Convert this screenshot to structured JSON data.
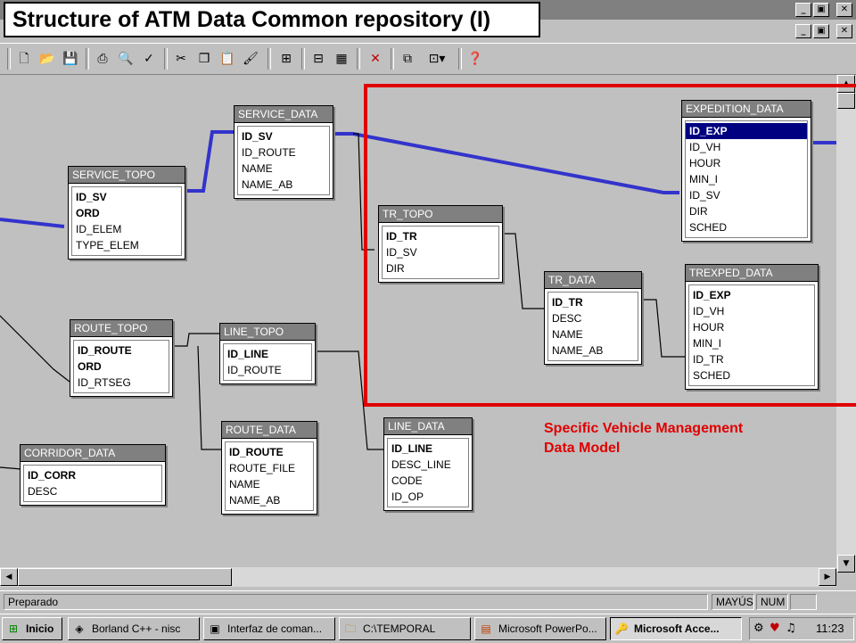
{
  "slide_title": "Structure of ATM Data Common repository (I)",
  "window_buttons": [
    "_",
    "▣",
    "✕"
  ],
  "toolbar_icons": [
    "new-icon",
    "open-icon",
    "save-icon",
    "print-icon",
    "print-preview-icon",
    "spelling-icon",
    "cut-icon",
    "copy-icon",
    "paste-icon",
    "format-painter-icon",
    "add-table-icon",
    "show-direct-icon",
    "show-all-icon",
    "delete-icon",
    "relationships-icon",
    "new-object-icon",
    "help-icon"
  ],
  "tables": [
    {
      "id": "service-data",
      "name": "SERVICE_DATA",
      "fields": [
        {
          "name": "ID_SV",
          "pk": true
        },
        {
          "name": "ID_ROUTE"
        },
        {
          "name": "NAME"
        },
        {
          "name": "NAME_AB"
        }
      ]
    },
    {
      "id": "service-topo",
      "name": "SERVICE_TOPO",
      "fields": [
        {
          "name": "ID_SV",
          "pk": true
        },
        {
          "name": "ORD",
          "pk": true
        },
        {
          "name": "ID_ELEM"
        },
        {
          "name": "TYPE_ELEM"
        }
      ]
    },
    {
      "id": "route-topo",
      "name": "ROUTE_TOPO",
      "fields": [
        {
          "name": "ID_ROUTE",
          "pk": true
        },
        {
          "name": "ORD",
          "pk": true
        },
        {
          "name": "ID_RTSEG"
        }
      ]
    },
    {
      "id": "line-topo",
      "name": "LINE_TOPO",
      "fields": [
        {
          "name": "ID_LINE",
          "pk": true
        },
        {
          "name": "ID_ROUTE"
        }
      ]
    },
    {
      "id": "corridor-data",
      "name": "CORRIDOR_DATA",
      "fields": [
        {
          "name": "ID_CORR",
          "pk": true
        },
        {
          "name": "DESC"
        }
      ]
    },
    {
      "id": "route-data",
      "name": "ROUTE_DATA",
      "fields": [
        {
          "name": "ID_ROUTE",
          "pk": true
        },
        {
          "name": "ROUTE_FILE"
        },
        {
          "name": "NAME"
        },
        {
          "name": "NAME_AB"
        }
      ]
    },
    {
      "id": "line-data",
      "name": "LINE_DATA",
      "fields": [
        {
          "name": "ID_LINE",
          "pk": true
        },
        {
          "name": "DESC_LINE"
        },
        {
          "name": "CODE"
        },
        {
          "name": "ID_OP"
        }
      ]
    },
    {
      "id": "tr-topo",
      "name": "TR_TOPO",
      "fields": [
        {
          "name": "ID_TR",
          "pk": true
        },
        {
          "name": "ID_SV"
        },
        {
          "name": "DIR"
        }
      ]
    },
    {
      "id": "tr-data",
      "name": "TR_DATA",
      "fields": [
        {
          "name": "ID_TR",
          "pk": true
        },
        {
          "name": "DESC"
        },
        {
          "name": "NAME"
        },
        {
          "name": "NAME_AB"
        }
      ]
    },
    {
      "id": "expedition-data",
      "name": "EXPEDITION_DATA",
      "fields": [
        {
          "name": "ID_EXP",
          "pk": true,
          "selected": true
        },
        {
          "name": "ID_VH"
        },
        {
          "name": "HOUR"
        },
        {
          "name": "MIN_I"
        },
        {
          "name": "ID_SV"
        },
        {
          "name": "DIR"
        },
        {
          "name": "SCHED"
        }
      ]
    },
    {
      "id": "trexped-data",
      "name": "TREXPED_DATA",
      "fields": [
        {
          "name": "ID_EXP",
          "pk": true
        },
        {
          "name": "ID_VH"
        },
        {
          "name": "HOUR"
        },
        {
          "name": "MIN_I"
        },
        {
          "name": "ID_TR"
        },
        {
          "name": "SCHED"
        }
      ]
    }
  ],
  "annotation": {
    "line1": "Specific Vehicle Management",
    "line2": "Data Model"
  },
  "statusbar": {
    "status": "Preparado",
    "caps": "MAYÚS",
    "num": "NUM"
  },
  "taskbar": {
    "start": "Inicio",
    "tasks": [
      {
        "label": "Borland C++ - nisc",
        "icon": "borland-icon"
      },
      {
        "label": "Interfaz de coman...",
        "icon": "console-icon"
      },
      {
        "label": "C:\\TEMPORAL",
        "icon": "folder-icon"
      },
      {
        "label": "Microsoft PowerPo...",
        "icon": "powerpoint-icon"
      },
      {
        "label": "Microsoft Acce...",
        "icon": "access-icon",
        "active": true
      }
    ],
    "clock": "11:23"
  },
  "colors": {
    "highlight_box": "#e00000",
    "relation_line": "#3333cc",
    "table_header": "#808080",
    "selected_field": "#000080"
  }
}
